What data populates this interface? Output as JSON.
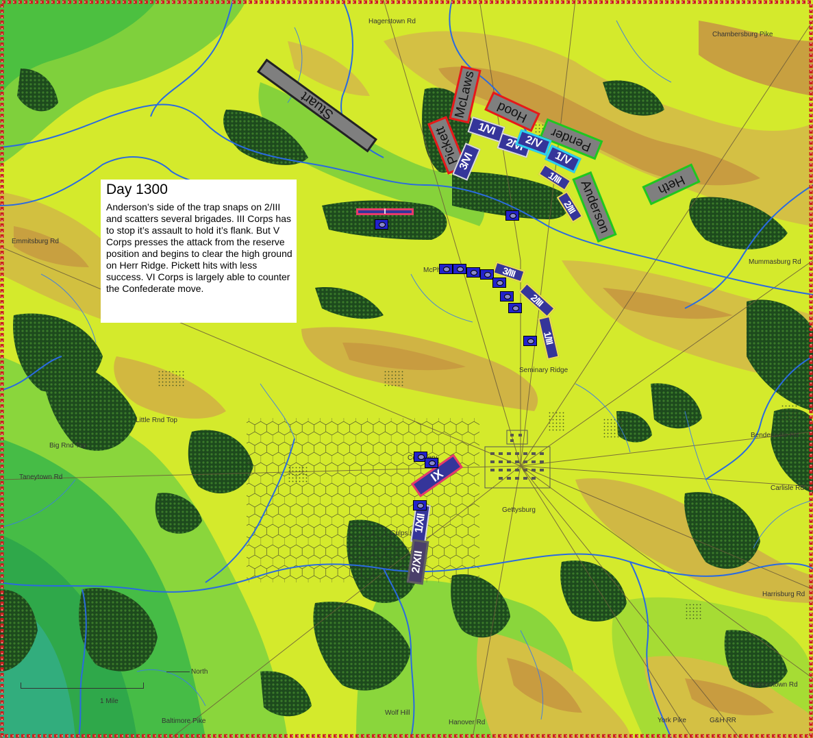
{
  "info": {
    "title": "Day 1300",
    "text": "Anderson’s side of the trap snaps on 2/III and scatters several brigades. III Corps has to stop it’s assault to hold it’s flank. But V Corps presses the attack from the reserve position and begins to clear the high ground on Herr Ridge. Pickett hits with less success. VI Corps is largely able to counter the Confederate move."
  },
  "roads": {
    "hagerstown": "Hagerstown Rd",
    "chambersburg": "Chambersburg Pike",
    "emmitsburg": "Emmitsburg Rd",
    "mummasburg": "Mummasburg Rd",
    "bendersville": "Bendersville Rd",
    "carlisle": "Carlisle Rd",
    "harrisburg": "Harrisburg Rd",
    "hunterstown": "Hunterstown Rd",
    "york": "York Pike",
    "gh_rr": "G&H RR",
    "hanover": "Hanover Rd",
    "baltimore": "Baltimore Pike",
    "taneytown": "Taneytown Rd"
  },
  "places": {
    "little_round_top": "Little Rnd Top",
    "big_round_top": "Big Rnd Top",
    "seminary_ridge": "Seminary Ridge",
    "gettysburg": "Gettysburg",
    "culps_hill": "Culps Hill",
    "cemetery": "Cemetery",
    "wolf_hill": "Wolf Hill",
    "mcpherson": "McPh"
  },
  "legend": {
    "north": "North",
    "mile": "1 Mile"
  },
  "confederate": {
    "stuart": "Stuart",
    "mclaws": "McLaws",
    "hood": "Hood",
    "pickett": "Pickett",
    "pender": "Pender",
    "heth": "Heth",
    "anderson": "Anderson"
  },
  "union": {
    "u_1vi": "1/VI",
    "u_2vi": "2/VI",
    "u_3vi": "3/VI",
    "u_2v": "2/V",
    "u_1v": "1/V",
    "u_1iii_top": "1/III",
    "u_2iii_top": "2/III",
    "u_3iii": "3/III",
    "u_2iii": "2/III",
    "u_1iii": "1/III",
    "u_ix": "IX",
    "u_1xii": "1/XII",
    "u_2xii": "2/XII",
    "u_i": "I"
  },
  "colors": {
    "confederate_fill": "#7f7f7f",
    "union_fill": "#35359a",
    "csa_border_red": "#e81818",
    "csa_border_green": "#1ec81e",
    "river": "#2a6ae0",
    "forest": "#1d4a1d",
    "terrain_low": "#3cc03c",
    "terrain_mid": "#d2ea2a",
    "terrain_high": "#c8a040",
    "frame": "#cc1e1e"
  }
}
